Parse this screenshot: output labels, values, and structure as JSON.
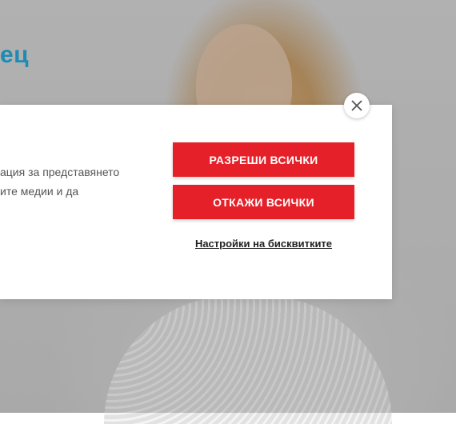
{
  "hero": {
    "title": "ец"
  },
  "cookie_dialog": {
    "text": "ация за представянето\nите медии и да",
    "allow_all_label": "РАЗРЕШИ ВСИЧКИ",
    "deny_all_label": "ОТКАЖИ ВСИЧКИ",
    "settings_link": "Настройки на бисквитките",
    "close_icon": "close-icon"
  },
  "colors": {
    "accent_red": "#e52028",
    "title_blue": "#1d8bb5"
  }
}
